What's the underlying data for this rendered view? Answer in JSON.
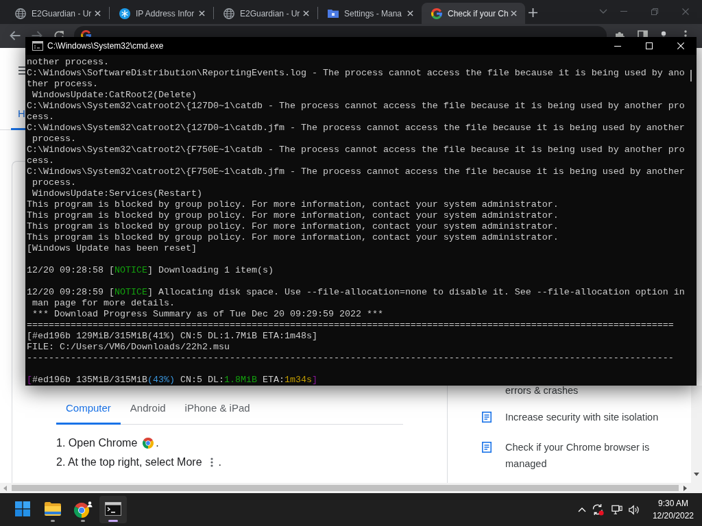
{
  "browser": {
    "tabs": [
      {
        "title": "E2Guardian - Ur",
        "kind": "globe",
        "selected": false
      },
      {
        "title": "IP Address Infor",
        "kind": "asterisk",
        "selected": false
      },
      {
        "title": "E2Guardian - Ur",
        "kind": "globe",
        "selected": false
      },
      {
        "title": "Settings - Mana",
        "kind": "folder",
        "selected": false
      },
      {
        "title": "Check if your Ch",
        "kind": "google",
        "selected": true
      }
    ]
  },
  "page": {
    "nav_tabs": [
      {
        "label": "H",
        "selected": true
      }
    ],
    "tabs": [
      {
        "label": "Computer",
        "selected": true
      },
      {
        "label": "Android",
        "selected": false
      },
      {
        "label": "iPhone & iPad",
        "selected": false
      }
    ],
    "steps": [
      {
        "text": "1. Open Chrome",
        "kind": "logo",
        "end": "."
      },
      {
        "text": "2. At the top right, select More",
        "kind": "more",
        "end": "."
      }
    ],
    "related": [
      {
        "text": "errors & crashes",
        "kind": "continuation"
      },
      {
        "text": "Increase security with site isolation",
        "kind": "article"
      },
      {
        "text": "Check if your Chrome browser is managed",
        "kind": "article"
      }
    ]
  },
  "console": {
    "title": "C:\\Windows\\System32\\cmd.exe",
    "lines": [
      {
        "kind": "text",
        "text": "nother process."
      },
      {
        "kind": "text",
        "text": "C:\\Windows\\SoftwareDistribution\\ReportingEvents.log - The process cannot access the file because it is being used by ano"
      },
      {
        "kind": "text",
        "text": "ther process."
      },
      {
        "kind": "text",
        "text": " WindowsUpdate:CatRoot2(Delete)"
      },
      {
        "kind": "text",
        "text": "C:\\Windows\\System32\\catroot2\\{127D0~1\\catdb - The process cannot access the file because it is being used by another pro"
      },
      {
        "kind": "text",
        "text": "cess."
      },
      {
        "kind": "text",
        "text": "C:\\Windows\\System32\\catroot2\\{127D0~1\\catdb.jfm - The process cannot access the file because it is being used by another"
      },
      {
        "kind": "text",
        "text": " process."
      },
      {
        "kind": "text",
        "text": "C:\\Windows\\System32\\catroot2\\{F750E~1\\catdb - The process cannot access the file because it is being used by another pro"
      },
      {
        "kind": "text",
        "text": "cess."
      },
      {
        "kind": "text",
        "text": "C:\\Windows\\System32\\catroot2\\{F750E~1\\catdb.jfm - The process cannot access the file because it is being used by another"
      },
      {
        "kind": "text",
        "text": " process."
      },
      {
        "kind": "text",
        "text": " WindowsUpdate:Services(Restart)"
      },
      {
        "kind": "text",
        "text": "This program is blocked by group policy. For more information, contact your system administrator."
      },
      {
        "kind": "text",
        "text": "This program is blocked by group policy. For more information, contact your system administrator."
      },
      {
        "kind": "text",
        "text": "This program is blocked by group policy. For more information, contact your system administrator."
      },
      {
        "kind": "text",
        "text": "This program is blocked by group policy. For more information, contact your system administrator."
      },
      {
        "kind": "text",
        "text": "[Windows Update has been reset]"
      },
      {
        "kind": "blank"
      },
      {
        "kind": "colored",
        "segments": [
          {
            "text": "12/20 09:28:58 [",
            "color": "#cccccc"
          },
          {
            "text": "NOTICE",
            "color": "#13a10e"
          },
          {
            "text": "] Downloading 1 item(s)",
            "color": "#cccccc"
          }
        ]
      },
      {
        "kind": "blank"
      },
      {
        "kind": "colored",
        "segments": [
          {
            "text": "12/20 09:28:59 [",
            "color": "#cccccc"
          },
          {
            "text": "NOTICE",
            "color": "#13a10e"
          },
          {
            "text": "] Allocating disk space. Use --file-allocation=none to disable it. See --file-allocation option in",
            "color": "#cccccc"
          }
        ]
      },
      {
        "kind": "text",
        "text": " man page for more details."
      },
      {
        "kind": "text",
        "text": " *** Download Progress Summary as of Tue Dec 20 09:29:59 2022 ***"
      },
      {
        "kind": "text",
        "text": "======================================================================================================================"
      },
      {
        "kind": "text",
        "text": "[#ed196b 129MiB/315MiB(41%) CN:5 DL:1.7MiB ETA:1m48s]"
      },
      {
        "kind": "text",
        "text": "FILE: C:/Users/VM6/Downloads/22h2.msu"
      },
      {
        "kind": "text",
        "text": "----------------------------------------------------------------------------------------------------------------------"
      },
      {
        "kind": "blank"
      },
      {
        "kind": "colored",
        "segments": [
          {
            "text": "[",
            "color": "#881798"
          },
          {
            "text": "#ed196b 135MiB/315MiB",
            "color": "#cccccc"
          },
          {
            "text": "(43%)",
            "color": "#3a96dd"
          },
          {
            "text": " CN:5 DL:",
            "color": "#cccccc"
          },
          {
            "text": "1.8MiB",
            "color": "#13a10e"
          },
          {
            "text": " ETA:",
            "color": "#cccccc"
          },
          {
            "text": "1m34s",
            "color": "#c19c00"
          },
          {
            "text": "]",
            "color": "#881798"
          }
        ]
      }
    ]
  },
  "taskbar": {
    "apps": [
      {
        "kind": "start",
        "running": false,
        "selected": false
      },
      {
        "kind": "explorer",
        "running": true,
        "selected": false
      },
      {
        "kind": "browser",
        "running": true,
        "selected": false
      },
      {
        "kind": "terminal",
        "running": true,
        "selected": true
      }
    ],
    "clock": {
      "time": "9:30 AM",
      "date": "12/20/2022"
    }
  }
}
